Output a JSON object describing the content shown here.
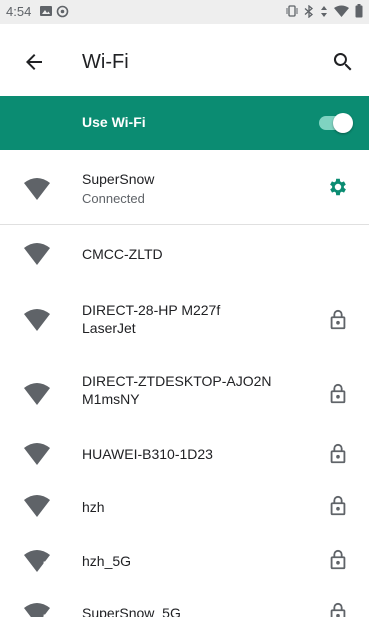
{
  "status_bar": {
    "time": "4:54",
    "icons_left": [
      "gallery-icon",
      "sync-icon"
    ],
    "icons_right": [
      "vibrate-icon",
      "bluetooth-icon",
      "data-icon",
      "wifi-icon",
      "battery-icon"
    ]
  },
  "app_bar": {
    "title": "Wi-Fi",
    "back_icon": "arrow-left-icon",
    "search_icon": "search-icon"
  },
  "use_wifi": {
    "label": "Use Wi-Fi",
    "enabled": true,
    "accent_color": "#0b8c72"
  },
  "networks": [
    {
      "name": "SuperSnow",
      "status": "Connected",
      "band": "4",
      "action": "settings-icon"
    },
    {
      "name": "CMCC-ZLTD",
      "status": "",
      "band": "4",
      "action": ""
    },
    {
      "name": "DIRECT-28-HP M227f LaserJet",
      "status": "",
      "band": "4",
      "action": "lock-icon"
    },
    {
      "name": "DIRECT-ZTDESKTOP-AJO2N M1msNY",
      "status": "",
      "band": "4",
      "action": "lock-icon"
    },
    {
      "name": "HUAWEI-B310-1D23",
      "status": "",
      "band": "4",
      "action": "lock-icon"
    },
    {
      "name": "hzh",
      "status": "",
      "band": "4",
      "action": "lock-icon"
    },
    {
      "name": "hzh_5G",
      "status": "",
      "band": "5",
      "action": "lock-icon"
    },
    {
      "name": "SuperSnow_5G",
      "status": "",
      "band": "5",
      "action": "lock-icon"
    }
  ]
}
